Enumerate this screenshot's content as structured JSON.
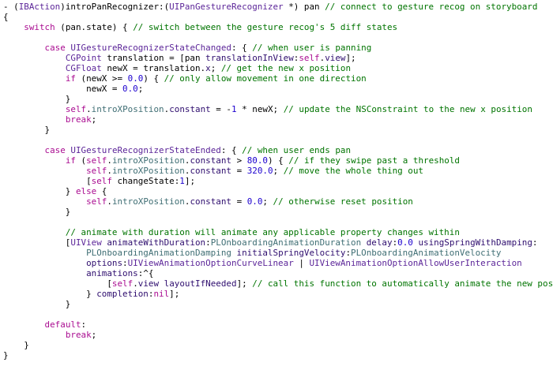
{
  "colors": {
    "background": "#ffffff",
    "plain": "#000000",
    "keyword": "#aa0d91",
    "comment": "#007400",
    "number": "#1c00cf",
    "type": "#5c2699",
    "method": "#2e0d6e",
    "project": "#3f6e74"
  },
  "code_lines": [
    [
      [
        "p",
        "- ("
      ],
      [
        "t",
        "IBAction"
      ],
      [
        "p",
        ")introPanRecognizer:("
      ],
      [
        "t",
        "UIPanGestureRecognizer"
      ],
      [
        "p",
        " *) pan "
      ],
      [
        "c",
        "// connect to gesture recog on storyboard"
      ]
    ],
    [
      [
        "p",
        "{"
      ]
    ],
    [
      [
        "p",
        "    "
      ],
      [
        "k",
        "switch"
      ],
      [
        "p",
        " (pan.state) { "
      ],
      [
        "c",
        "// switch between the gesture recog's 5 diff states"
      ]
    ],
    [],
    [
      [
        "p",
        "        "
      ],
      [
        "k",
        "case"
      ],
      [
        "p",
        " "
      ],
      [
        "t",
        "UIGestureRecognizerStateChanged"
      ],
      [
        "p",
        ": { "
      ],
      [
        "c",
        "// when user is panning"
      ]
    ],
    [
      [
        "p",
        "            "
      ],
      [
        "t",
        "CGPoint"
      ],
      [
        "p",
        " translation = [pan "
      ],
      [
        "m",
        "translationInView"
      ],
      [
        "p",
        ":"
      ],
      [
        "k",
        "self"
      ],
      [
        "p",
        "."
      ],
      [
        "m",
        "view"
      ],
      [
        "p",
        "];"
      ]
    ],
    [
      [
        "p",
        "            "
      ],
      [
        "t",
        "CGFloat"
      ],
      [
        "p",
        " newX = translation."
      ],
      [
        "m",
        "x"
      ],
      [
        "p",
        "; "
      ],
      [
        "c",
        "// get the new x position"
      ]
    ],
    [
      [
        "p",
        "            "
      ],
      [
        "k",
        "if"
      ],
      [
        "p",
        " (newX >= "
      ],
      [
        "n",
        "0.0"
      ],
      [
        "p",
        ") { "
      ],
      [
        "c",
        "// only allow movement in one direction"
      ]
    ],
    [
      [
        "p",
        "                newX = "
      ],
      [
        "n",
        "0.0"
      ],
      [
        "p",
        ";"
      ]
    ],
    [
      [
        "p",
        "            }"
      ]
    ],
    [
      [
        "p",
        "            "
      ],
      [
        "k",
        "self"
      ],
      [
        "p",
        "."
      ],
      [
        "r",
        "introXPosition"
      ],
      [
        "p",
        "."
      ],
      [
        "m",
        "constant"
      ],
      [
        "p",
        " = -"
      ],
      [
        "n",
        "1"
      ],
      [
        "p",
        " * newX; "
      ],
      [
        "c",
        "// update the NSConstraint to the new x position"
      ]
    ],
    [
      [
        "p",
        "            "
      ],
      [
        "k",
        "break"
      ],
      [
        "p",
        ";"
      ]
    ],
    [
      [
        "p",
        "        }"
      ]
    ],
    [],
    [
      [
        "p",
        "        "
      ],
      [
        "k",
        "case"
      ],
      [
        "p",
        " "
      ],
      [
        "t",
        "UIGestureRecognizerStateEnded"
      ],
      [
        "p",
        ": { "
      ],
      [
        "c",
        "// when user ends pan"
      ]
    ],
    [
      [
        "p",
        "            "
      ],
      [
        "k",
        "if"
      ],
      [
        "p",
        " ("
      ],
      [
        "k",
        "self"
      ],
      [
        "p",
        "."
      ],
      [
        "r",
        "introXPosition"
      ],
      [
        "p",
        "."
      ],
      [
        "m",
        "constant"
      ],
      [
        "p",
        " > "
      ],
      [
        "n",
        "80.0"
      ],
      [
        "p",
        ") { "
      ],
      [
        "c",
        "// if they swipe past a threshold"
      ]
    ],
    [
      [
        "p",
        "                "
      ],
      [
        "k",
        "self"
      ],
      [
        "p",
        "."
      ],
      [
        "r",
        "introXPosition"
      ],
      [
        "p",
        "."
      ],
      [
        "m",
        "constant"
      ],
      [
        "p",
        " = "
      ],
      [
        "n",
        "320.0"
      ],
      [
        "p",
        "; "
      ],
      [
        "c",
        "// move the whole thing out"
      ]
    ],
    [
      [
        "p",
        "                ["
      ],
      [
        "k",
        "self"
      ],
      [
        "p",
        " changeState:"
      ],
      [
        "n",
        "1"
      ],
      [
        "p",
        "];"
      ]
    ],
    [
      [
        "p",
        "            } "
      ],
      [
        "k",
        "else"
      ],
      [
        "p",
        " {"
      ]
    ],
    [
      [
        "p",
        "                "
      ],
      [
        "k",
        "self"
      ],
      [
        "p",
        "."
      ],
      [
        "r",
        "introXPosition"
      ],
      [
        "p",
        "."
      ],
      [
        "m",
        "constant"
      ],
      [
        "p",
        " = "
      ],
      [
        "n",
        "0.0"
      ],
      [
        "p",
        "; "
      ],
      [
        "c",
        "// otherwise reset position"
      ]
    ],
    [
      [
        "p",
        "            }"
      ]
    ],
    [],
    [
      [
        "p",
        "            "
      ],
      [
        "c",
        "// animate with duration will animate any applicable property changes within"
      ]
    ],
    [
      [
        "p",
        "            ["
      ],
      [
        "t",
        "UIView"
      ],
      [
        "p",
        " "
      ],
      [
        "m",
        "animateWithDuration"
      ],
      [
        "p",
        ":"
      ],
      [
        "r",
        "PLOnboardingAnimationDuration"
      ],
      [
        "p",
        " "
      ],
      [
        "m",
        "delay"
      ],
      [
        "p",
        ":"
      ],
      [
        "n",
        "0.0"
      ],
      [
        "p",
        " "
      ],
      [
        "m",
        "usingSpringWithDamping"
      ],
      [
        "p",
        ":"
      ]
    ],
    [
      [
        "p",
        "                "
      ],
      [
        "r",
        "PLOnboardingAnimationDamping"
      ],
      [
        "p",
        " "
      ],
      [
        "m",
        "initialSpringVelocity"
      ],
      [
        "p",
        ":"
      ],
      [
        "r",
        "PLOnboardingAnimationVelocity"
      ]
    ],
    [
      [
        "p",
        "                "
      ],
      [
        "m",
        "options"
      ],
      [
        "p",
        ":"
      ],
      [
        "t",
        "UIViewAnimationOptionCurveLinear"
      ],
      [
        "p",
        " | "
      ],
      [
        "t",
        "UIViewAnimationOptionAllowUserInteraction"
      ]
    ],
    [
      [
        "p",
        "                "
      ],
      [
        "m",
        "animations"
      ],
      [
        "p",
        ":^{"
      ]
    ],
    [
      [
        "p",
        "                    ["
      ],
      [
        "k",
        "self"
      ],
      [
        "p",
        "."
      ],
      [
        "m",
        "view"
      ],
      [
        "p",
        " "
      ],
      [
        "m",
        "layoutIfNeeded"
      ],
      [
        "p",
        "]; "
      ],
      [
        "c",
        "// call this function to automatically animate the new pos"
      ]
    ],
    [
      [
        "p",
        "                } "
      ],
      [
        "m",
        "completion"
      ],
      [
        "p",
        ":"
      ],
      [
        "k",
        "nil"
      ],
      [
        "p",
        "];"
      ]
    ],
    [
      [
        "p",
        "            }"
      ]
    ],
    [],
    [
      [
        "p",
        "        "
      ],
      [
        "k",
        "default"
      ],
      [
        "p",
        ":"
      ]
    ],
    [
      [
        "p",
        "            "
      ],
      [
        "k",
        "break"
      ],
      [
        "p",
        ";"
      ]
    ],
    [
      [
        "p",
        "    }"
      ]
    ],
    [
      [
        "p",
        "}"
      ]
    ]
  ],
  "cursor_line": 27
}
